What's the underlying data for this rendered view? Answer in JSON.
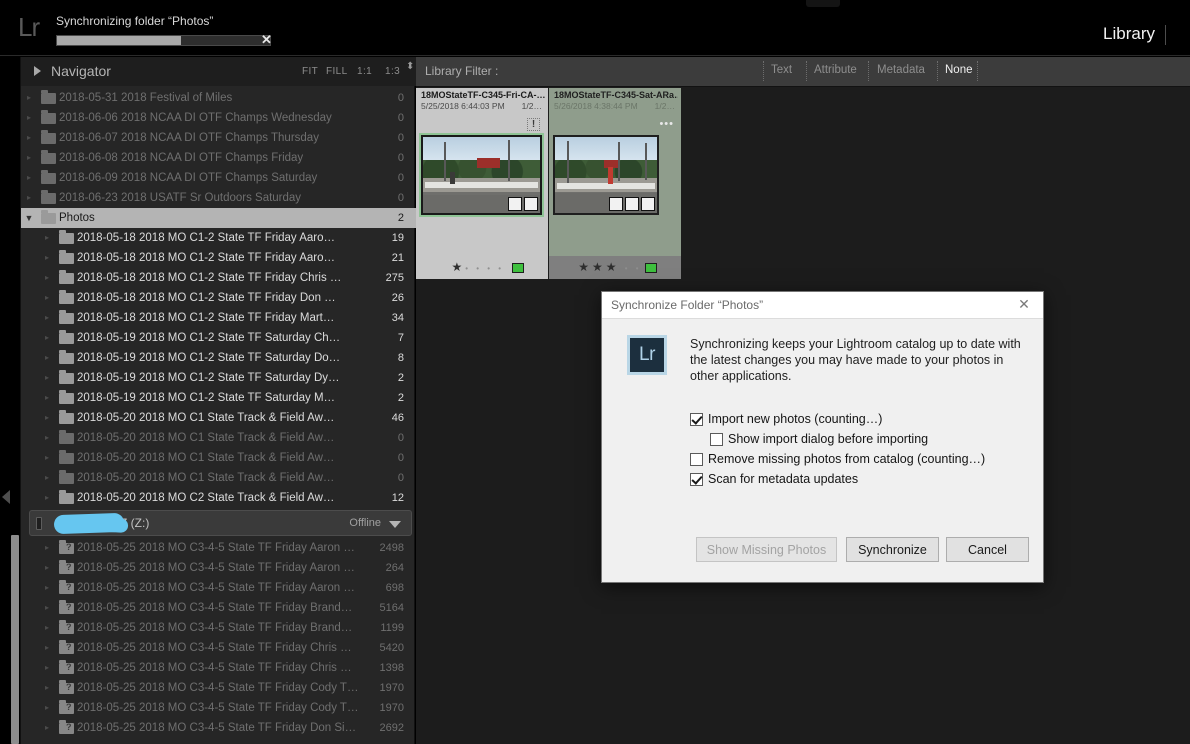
{
  "topbar": {
    "logo": "Lr",
    "sync_status": "Synchronizing folder “Photos”",
    "progress_percent": 58,
    "cancel_glyph": "✕",
    "module": "Library"
  },
  "navigator": {
    "title": "Navigator",
    "zoom_levels": [
      "FIT",
      "FILL",
      "1:1",
      "1:3"
    ],
    "stepper_glyph": "⬍"
  },
  "library_filter": {
    "label": "Library Filter :",
    "chips": [
      "Text",
      "Attribute",
      "Metadata",
      "None"
    ],
    "active": "None"
  },
  "folders": [
    {
      "name": "2018-05-31 2018 Festival of Miles",
      "count": "0",
      "state": "dim",
      "indent": 0,
      "icon": "folder-icon"
    },
    {
      "name": "2018-06-06 2018 NCAA DI OTF Champs Wednesday",
      "count": "0",
      "state": "dim",
      "indent": 0,
      "icon": "folder-icon"
    },
    {
      "name": "2018-06-07 2018 NCAA DI OTF Champs Thursday",
      "count": "0",
      "state": "dim",
      "indent": 0,
      "icon": "folder-icon"
    },
    {
      "name": "2018-06-08 2018 NCAA DI OTF Champs Friday",
      "count": "0",
      "state": "dim",
      "indent": 0,
      "icon": "folder-icon"
    },
    {
      "name": "2018-06-09 2018 NCAA DI OTF Champs Saturday",
      "count": "0",
      "state": "dim",
      "indent": 0,
      "icon": "folder-icon"
    },
    {
      "name": "2018-06-23 2018 USATF Sr Outdoors Saturday",
      "count": "0",
      "state": "dim",
      "indent": 0,
      "icon": "folder-icon"
    },
    {
      "name": "Photos",
      "count": "2",
      "state": "selected",
      "indent": 0,
      "icon": "folder-icon",
      "expanded": true
    },
    {
      "name": "2018-05-18 2018 MO C1-2 State TF Friday Aaro…",
      "count": "19",
      "state": "brite",
      "indent": 1,
      "icon": "folder-icon"
    },
    {
      "name": "2018-05-18 2018 MO C1-2 State TF Friday Aaro…",
      "count": "21",
      "state": "brite",
      "indent": 1,
      "icon": "folder-icon"
    },
    {
      "name": "2018-05-18 2018 MO C1-2 State TF Friday Chris …",
      "count": "275",
      "state": "brite",
      "indent": 1,
      "icon": "folder-icon"
    },
    {
      "name": "2018-05-18 2018 MO C1-2 State TF Friday Don …",
      "count": "26",
      "state": "brite",
      "indent": 1,
      "icon": "folder-icon"
    },
    {
      "name": "2018-05-18 2018 MO C1-2 State TF Friday Mart…",
      "count": "34",
      "state": "brite",
      "indent": 1,
      "icon": "folder-icon"
    },
    {
      "name": "2018-05-19 2018 MO C1-2 State TF Saturday Ch…",
      "count": "7",
      "state": "brite",
      "indent": 1,
      "icon": "folder-icon"
    },
    {
      "name": "2018-05-19 2018 MO C1-2 State TF Saturday Do…",
      "count": "8",
      "state": "brite",
      "indent": 1,
      "icon": "folder-icon"
    },
    {
      "name": "2018-05-19 2018 MO C1-2 State TF Saturday Dy…",
      "count": "2",
      "state": "brite",
      "indent": 1,
      "icon": "folder-icon"
    },
    {
      "name": "2018-05-19 2018 MO C1-2 State TF Saturday M…",
      "count": "2",
      "state": "brite",
      "indent": 1,
      "icon": "folder-icon"
    },
    {
      "name": "2018-05-20 2018 MO C1 State Track & Field Aw…",
      "count": "46",
      "state": "brite",
      "indent": 1,
      "icon": "folder-icon"
    },
    {
      "name": "2018-05-20 2018 MO C1 State Track & Field Aw…",
      "count": "0",
      "state": "dim",
      "indent": 1,
      "icon": "folder-icon"
    },
    {
      "name": "2018-05-20 2018 MO C1 State Track & Field Aw…",
      "count": "0",
      "state": "dim",
      "indent": 1,
      "icon": "folder-icon"
    },
    {
      "name": "2018-05-20 2018 MO C1 State Track & Field Aw…",
      "count": "0",
      "state": "dim",
      "indent": 1,
      "icon": "folder-icon"
    },
    {
      "name": "2018-05-20 2018 MO C2 State Track & Field Aw…",
      "count": "12",
      "state": "brite",
      "indent": 1,
      "icon": "folder-icon"
    }
  ],
  "drive": {
    "name_suffix": "Z (Z:)",
    "status": "Offline",
    "redacted": true,
    "icon": "drive-icon"
  },
  "offline_folders": [
    {
      "name": "2018-05-25 2018 MO C3-4-5 State TF Friday Aaron …",
      "count": "2498"
    },
    {
      "name": "2018-05-25 2018 MO C3-4-5 State TF Friday Aaron …",
      "count": "264"
    },
    {
      "name": "2018-05-25 2018 MO C3-4-5 State TF Friday Aaron …",
      "count": "698"
    },
    {
      "name": "2018-05-25 2018 MO C3-4-5 State TF Friday Brand…",
      "count": "5164"
    },
    {
      "name": "2018-05-25 2018 MO C3-4-5 State TF Friday Brand…",
      "count": "1199"
    },
    {
      "name": "2018-05-25 2018 MO C3-4-5 State TF Friday Chris …",
      "count": "5420"
    },
    {
      "name": "2018-05-25 2018 MO C3-4-5 State TF Friday Chris …",
      "count": "1398"
    },
    {
      "name": "2018-05-25 2018 MO C3-4-5 State TF Friday Cody T…",
      "count": "1970"
    },
    {
      "name": "2018-05-25 2018 MO C3-4-5 State TF Friday Cody T…",
      "count": "1970"
    },
    {
      "name": "2018-05-25 2018 MO C3-4-5 State TF Friday Don Si…",
      "count": "2692"
    }
  ],
  "grid": {
    "cells": [
      {
        "filename": "18MOStateTF-C345-Fri-CA-…",
        "date": "5/25/2018 6:44:03 PM",
        "copy": "1/2…",
        "rating": 1,
        "rating_max": 5,
        "color_label": "#3ec03e",
        "badge": "!",
        "selected": true
      },
      {
        "filename": "18MOStateTF-C345-Sat-ARa…",
        "date": "5/26/2018 4:38:44 PM",
        "copy": "1/2…",
        "rating": 3,
        "rating_max": 5,
        "color_label": "#3ec03e",
        "badge": "•••",
        "selected": false
      }
    ]
  },
  "modal": {
    "title": "Synchronize Folder “Photos”",
    "close_glyph": "✕",
    "app_icon": "Lr",
    "description": "Synchronizing keeps your Lightroom catalog up to date with the latest changes you may have made to your photos in other applications.",
    "checkboxes": [
      {
        "label": "Import new photos (counting…)",
        "checked": true
      },
      {
        "label": "Show import dialog before importing",
        "checked": false
      },
      {
        "label": "Remove missing photos from catalog (counting…)",
        "checked": false
      },
      {
        "label": "Scan for metadata updates",
        "checked": true
      }
    ],
    "buttons": [
      {
        "label": "Show Missing Photos",
        "disabled": true
      },
      {
        "label": "Synchronize",
        "disabled": false
      },
      {
        "label": "Cancel",
        "disabled": false
      }
    ]
  },
  "colors": {
    "accent_green": "#3ec03e",
    "redaction_blue": "#66c6f0",
    "panel_bg": "#262626",
    "content_bg": "#1c1c1c"
  }
}
